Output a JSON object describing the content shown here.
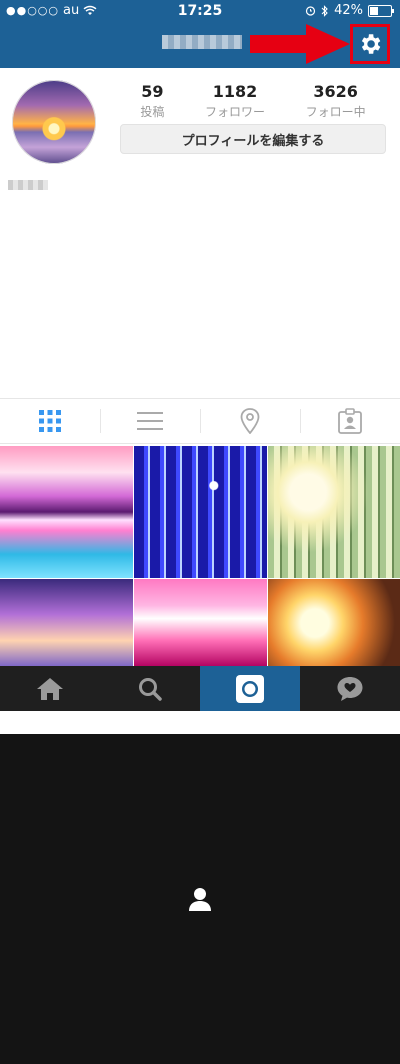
{
  "status_bar": {
    "carrier": "au",
    "signal_dots": "●●○○○",
    "time": "17:25",
    "battery_percent": "42%"
  },
  "profile": {
    "stats": [
      {
        "value": "59",
        "label": "投稿"
      },
      {
        "value": "1182",
        "label": "フォロワー"
      },
      {
        "value": "3626",
        "label": "フォロー中"
      }
    ],
    "edit_button_label": "プロフィールを編集する"
  },
  "tabs": [
    {
      "icon": "grid-icon",
      "active": true
    },
    {
      "icon": "list-icon",
      "active": false
    },
    {
      "icon": "location-pin-icon",
      "active": false
    },
    {
      "icon": "tagged-person-icon",
      "active": false
    }
  ],
  "bottom_nav": [
    {
      "icon": "home-icon"
    },
    {
      "icon": "search-icon"
    },
    {
      "icon": "camera-icon"
    },
    {
      "icon": "activity-heart-icon"
    },
    {
      "icon": "profile-icon"
    }
  ],
  "colors": {
    "header_bg": "#1d6196",
    "highlight_red": "#e60012",
    "active_tab": "#3897f0",
    "nav_bg": "#1f1f1f"
  }
}
